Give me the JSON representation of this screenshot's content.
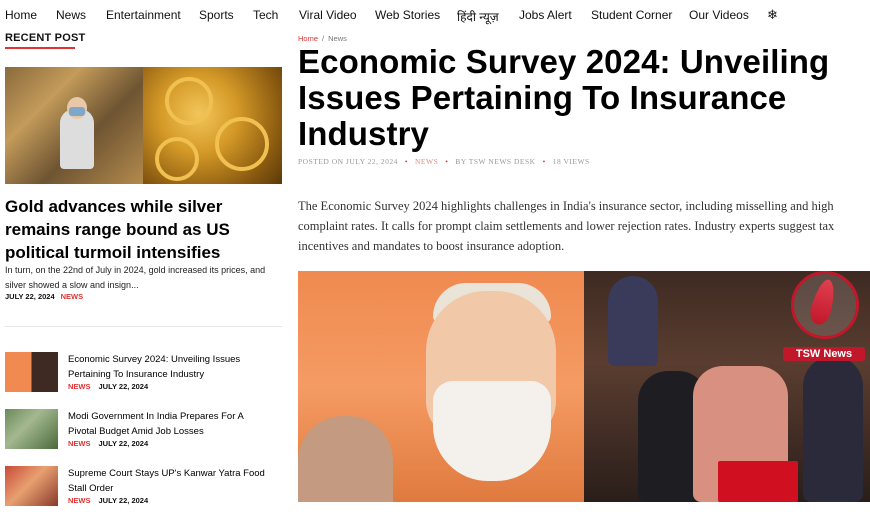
{
  "nav": {
    "items": [
      "Home",
      "News",
      "Entertainment",
      "Sports",
      "Tech",
      "Viral Video",
      "Web Stories",
      "हिंदी न्यूज़",
      "Jobs Alert",
      "Student Corner",
      "Our Videos"
    ],
    "settings_icon": "gear-icon",
    "settings_glyph": "❄"
  },
  "sidebar": {
    "heading": "RECENT POST",
    "featured": {
      "title": "Gold advances while silver remains range bound as US political turmoil intensifies",
      "excerpt": "In turn, on the 22nd of July in 2024, gold increased its prices, and silver showed a slow and insign...",
      "date": "JULY 22, 2024",
      "category": "NEWS"
    },
    "posts": [
      {
        "title": "Economic Survey 2024: Unveiling Issues Pertaining To Insurance Industry",
        "category": "NEWS",
        "date": "JULY 22, 2024"
      },
      {
        "title": "Modi Government In India Prepares For A Pivotal Budget Amid Job Losses",
        "category": "NEWS",
        "date": "JULY 22, 2024"
      },
      {
        "title": "Supreme Court Stays UP's Kanwar Yatra Food Stall Order",
        "category": "NEWS",
        "date": "JULY 22, 2024"
      }
    ]
  },
  "article": {
    "breadcrumb": {
      "home": "Home",
      "sep": "/",
      "current": "News"
    },
    "title": "Economic Survey 2024: Unveiling Issues Pertaining To Insurance Industry",
    "meta": {
      "posted": "POSTED ON JULY 22, 2024",
      "category": "NEWS",
      "author": "BY TSW NEWS DESK",
      "views": "18 VIEWS"
    },
    "summary": "The Economic Survey 2024 highlights challenges in India's insurance sector, including misselling and high complaint rates. It calls for prompt claim settlements and lower rejection rates. Industry experts suggest tax incentives and mandates to boost insurance adoption.",
    "image_logo_text": "TSW News"
  },
  "colors": {
    "accent": "#dd3333",
    "logo_red": "#c0182a"
  }
}
